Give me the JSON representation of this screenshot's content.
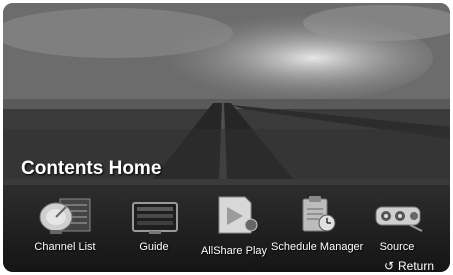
{
  "header": {
    "title": "Contents Home"
  },
  "items": [
    {
      "label": "Channel List",
      "icon": "satellite-dish-icon"
    },
    {
      "label": "Guide",
      "icon": "tv-guide-icon"
    },
    {
      "label": "AllShare Play",
      "icon": "allshare-play-icon"
    },
    {
      "label": "Schedule Manager",
      "icon": "schedule-manager-icon"
    },
    {
      "label": "Source",
      "icon": "source-icon"
    }
  ],
  "footer": {
    "return_label": "Return",
    "return_icon": "return-arrow-icon"
  }
}
